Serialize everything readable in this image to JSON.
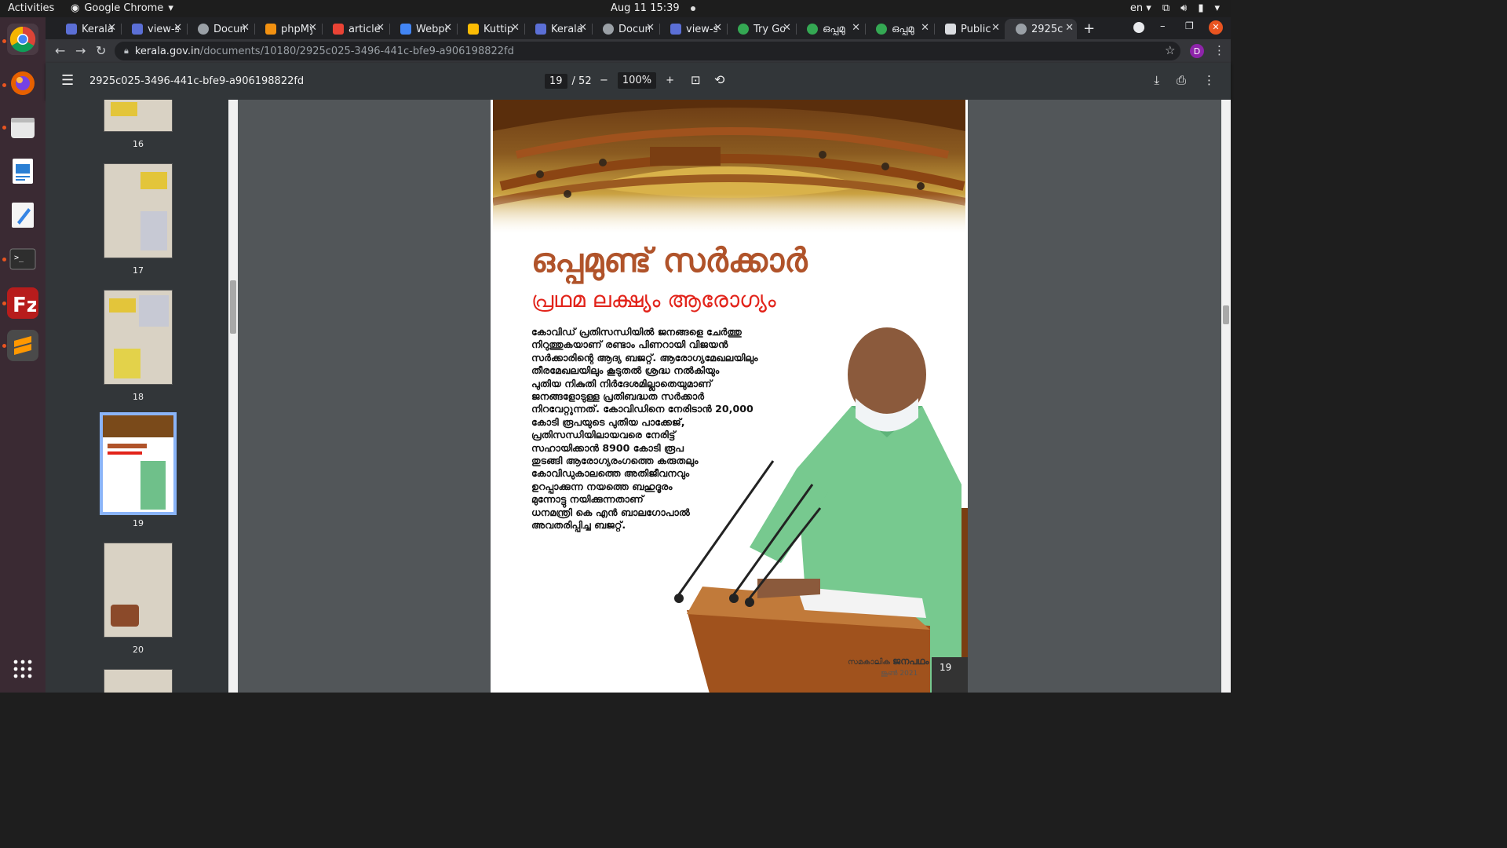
{
  "topbar": {
    "activities": "Activities",
    "app": "Google Chrome",
    "datetime": "Aug 11  15:39",
    "lang": "en"
  },
  "tabs": [
    {
      "label": "Kerala",
      "color": "#5b6fd6"
    },
    {
      "label": "view-s",
      "color": "#5b6fd6"
    },
    {
      "label": "Docum",
      "color": "#9aa0a6"
    },
    {
      "label": "phpMy",
      "color": "#f29111"
    },
    {
      "label": "article",
      "color": "#ea4335"
    },
    {
      "label": "Webpa",
      "color": "#4285f4"
    },
    {
      "label": "Kuttip",
      "color": "#fbbc04"
    },
    {
      "label": "Kerala",
      "color": "#5b6fd6"
    },
    {
      "label": "Docum",
      "color": "#9aa0a6"
    },
    {
      "label": "view-s",
      "color": "#5b6fd6"
    },
    {
      "label": "Try Go",
      "color": "#34a853"
    },
    {
      "label": "ഒപ്പമു",
      "color": "#34a853"
    },
    {
      "label": "ഒപ്പമു",
      "color": "#34a853"
    },
    {
      "label": "Public",
      "color": "#dadce0"
    },
    {
      "label": "2925c0",
      "color": "#9aa0a6"
    }
  ],
  "address": {
    "host": "kerala.gov.in",
    "path": "/documents/10180/2925c025-3496-441c-bfe9-a906198822fd"
  },
  "profile_initial": "D",
  "pdf": {
    "title": "2925c025-3496-441c-bfe9-a906198822fd",
    "current_page": "19",
    "total_pages": "/ 52",
    "zoom": "100%"
  },
  "thumbnails": [
    {
      "num": "16"
    },
    {
      "num": "17"
    },
    {
      "num": "18"
    },
    {
      "num": "19"
    },
    {
      "num": "20"
    }
  ],
  "article": {
    "headline": "ഒപ്പമുണ്ട് സർക്കാർ",
    "subhead": "പ്രഥമ ലക്ഷ്യം ആരോഗ്യം",
    "body_lines": [
      "കോവിഡ് പ്രതിസന്ധിയിൽ  ജനങ്ങളെ ചേർത്തു",
      "നിറുത്തുകയാണ് രണ്ടാം പിണറായി വിജയൻ",
      "സർക്കാരിന്റെ ആദ്യ ബജറ്റ്. ആരോഗ്യമേഖലയിലും",
      "തീരമേഖലയിലും കൂടുതൽ ശ്രദ്ധ നൽകിയും",
      "പുതിയ നികുതി നിർദേശമില്ലാതെയുമാണ്",
      "ജനങ്ങളോടുള്ള പ്രതിബദ്ധത സർക്കാർ",
      "നിറവേറ്റുന്നത്. കോവിഡിനെ നേരിടാൻ 20,000",
      "കോടി രൂപയുടെ പുതിയ പാക്കേജ്,",
      "പ്രതിസന്ധിയിലായവരെ നേരിട്ട്",
      "സഹായിക്കാൻ 8900 കോടി രൂപ",
      "തുടങ്ങി  ആരോഗ്യരംഗത്തെ കരുതലും",
      "കോവിഡുകാലത്തെ അതിജീവനവും",
      "ഉറപ്പാക്കുന്ന നയത്തെ ബഹുദൂരം",
      "മുന്നോട്ടു നയിക്കുന്നതാണ്",
      "ധനമന്ത്രി കെ എൻ ബാലഗോപാൽ",
      "അവതരിപ്പിച്ച ബജറ്റ്."
    ],
    "magazine": "സമകാലിക",
    "magazine_brand": "ജനപഥം",
    "date": "ജൂൺ  2021",
    "page_number": "19"
  }
}
